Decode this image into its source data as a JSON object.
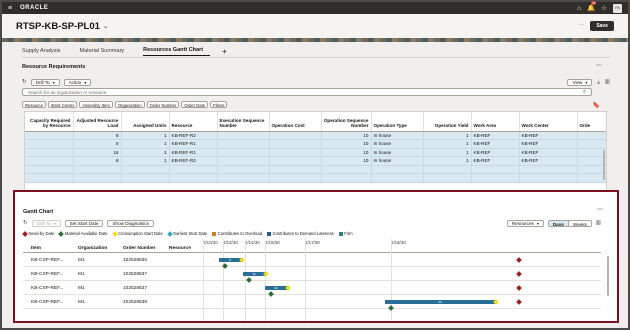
{
  "topbar": {
    "brand": "ORACLE",
    "notification_count": "24",
    "user_initials": "PA"
  },
  "header": {
    "title": "RTSP-KB-SP-PL01",
    "save_label": "Save"
  },
  "tabs": [
    {
      "label": "Supply Analysis"
    },
    {
      "label": "Material Summary"
    },
    {
      "label": "Resources Gantt Chart"
    }
  ],
  "resource_requirements": {
    "title": "Resource Requirements",
    "drill_to": "Drill To",
    "action": "Action",
    "view": "View",
    "search_placeholder": "Search for an organization or resource",
    "filter_chips": [
      "Resource",
      "Work Center",
      "Assembly Item",
      "Organization",
      "Order Number",
      "Order Date",
      "Filters"
    ],
    "columns": [
      "Capacity Required by Resource",
      "Adjusted Resource Load",
      "Assigned Units",
      "Resource",
      "Execution Sequence Number",
      "Operation Cost",
      "Operation Sequence Number",
      "Operation Type",
      "Operation Yield",
      "Work Area",
      "Work Center",
      "Orde"
    ],
    "rows": [
      [
        "",
        "8",
        "1",
        "KB-REF-R2",
        "",
        "",
        "10",
        "In house",
        "1",
        "KB-REF",
        "KB-REF",
        ""
      ],
      [
        "",
        "8",
        "1",
        "KB-REF-R1",
        "",
        "",
        "10",
        "In house",
        "1",
        "KB-REF",
        "KB-REF",
        ""
      ],
      [
        "",
        "16",
        "1",
        "KB-REF-R1",
        "",
        "",
        "10",
        "In house",
        "1",
        "KB-REF",
        "KB-REF",
        ""
      ],
      [
        "",
        "8",
        "1",
        "KB-REF-R2",
        "",
        "",
        "10",
        "In house",
        "1",
        "KB-REF",
        "KB-REF",
        ""
      ],
      [
        "",
        "",
        "",
        "",
        "",
        "",
        "",
        "",
        "",
        "",
        "",
        ""
      ],
      [
        "",
        "",
        "",
        "",
        "",
        "",
        "",
        "",
        "",
        "",
        "",
        ""
      ]
    ]
  },
  "gantt": {
    "title": "Gantt Chart",
    "drill_to": "Drill To",
    "set_start_date": "Set Start Date",
    "show_diagnostics": "Show Diagnostics",
    "resources": "Resources",
    "days": "Days",
    "weeks": "Weeks",
    "legend": [
      {
        "label": "Need-by Date",
        "shape": "diamond",
        "color": "#9c1f1f"
      },
      {
        "label": "Material Available Date",
        "shape": "diamond",
        "color": "#2d6a3a"
      },
      {
        "label": "Consumption Start Date",
        "shape": "diamond",
        "color": "#f2dc1d"
      },
      {
        "label": "Earliest Start Date",
        "shape": "diamond",
        "color": "#3aa4c9"
      },
      {
        "label": "Contributes to Overload",
        "shape": "square",
        "color": "#d97a2b"
      },
      {
        "label": "Contributes to Demand Lateness",
        "shape": "square",
        "color": "#1f5f8b"
      },
      {
        "label": "Firm",
        "shape": "square",
        "color": "#2d7d7b"
      }
    ],
    "columns": [
      "Item",
      "Organization",
      "Order Number",
      "Resource"
    ],
    "dates": [
      "2/10/30",
      "2/12/30",
      "2/14/30",
      "2/15/30",
      "2/17/30",
      "2/18/30"
    ],
    "rows": [
      {
        "item": "KB-CSP-REF...",
        "org": "M1",
        "order": "102528636",
        "bar_label": "8"
      },
      {
        "item": "KB-CSP-REF...",
        "org": "M1",
        "order": "102528637",
        "bar_label": "16"
      },
      {
        "item": "KB-CSP-REF...",
        "org": "M1",
        "order": "102528637",
        "bar_label": "22"
      },
      {
        "item": "KB-CSP-REF...",
        "org": "M1",
        "order": "102528638",
        "bar_label": "40"
      }
    ]
  }
}
